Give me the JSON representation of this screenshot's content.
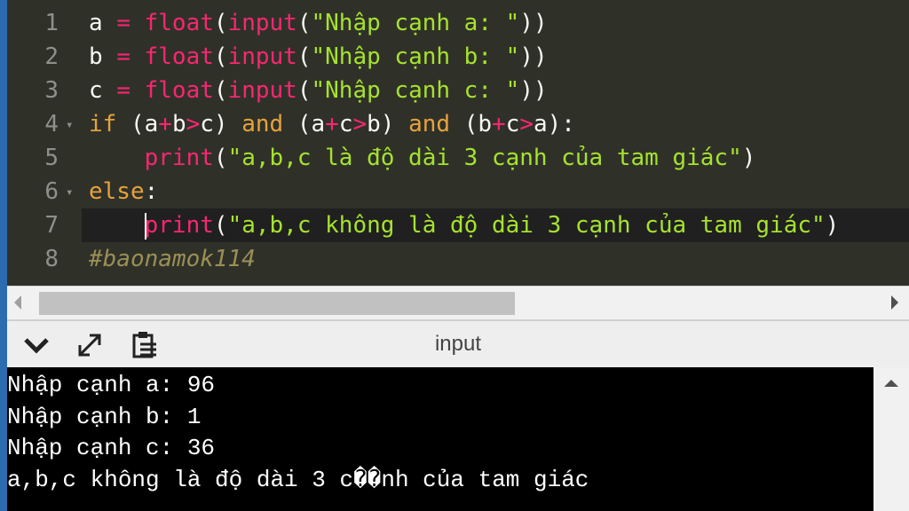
{
  "editor": {
    "lines": [
      {
        "num": "1",
        "parts": [
          {
            "t": "a ",
            "c": ""
          },
          {
            "t": "=",
            "c": "op"
          },
          {
            "t": " ",
            "c": ""
          },
          {
            "t": "float",
            "c": "kw"
          },
          {
            "t": "(",
            "c": ""
          },
          {
            "t": "input",
            "c": "kw"
          },
          {
            "t": "(",
            "c": ""
          },
          {
            "t": "\"Nhập cạnh a: \"",
            "c": "str"
          },
          {
            "t": "))",
            "c": ""
          }
        ]
      },
      {
        "num": "2",
        "parts": [
          {
            "t": "b ",
            "c": ""
          },
          {
            "t": "=",
            "c": "op"
          },
          {
            "t": " ",
            "c": ""
          },
          {
            "t": "float",
            "c": "kw"
          },
          {
            "t": "(",
            "c": ""
          },
          {
            "t": "input",
            "c": "kw"
          },
          {
            "t": "(",
            "c": ""
          },
          {
            "t": "\"Nhập cạnh b: \"",
            "c": "str"
          },
          {
            "t": "))",
            "c": ""
          }
        ]
      },
      {
        "num": "3",
        "parts": [
          {
            "t": "c ",
            "c": ""
          },
          {
            "t": "=",
            "c": "op"
          },
          {
            "t": " ",
            "c": ""
          },
          {
            "t": "float",
            "c": "kw"
          },
          {
            "t": "(",
            "c": ""
          },
          {
            "t": "input",
            "c": "kw"
          },
          {
            "t": "(",
            "c": ""
          },
          {
            "t": "\"Nhập cạnh c: \"",
            "c": "str"
          },
          {
            "t": "))",
            "c": ""
          }
        ]
      },
      {
        "num": "4",
        "fold": true,
        "parts": [
          {
            "t": "if",
            "c": "ctl"
          },
          {
            "t": " (a",
            "c": ""
          },
          {
            "t": "+",
            "c": "op"
          },
          {
            "t": "b",
            "c": ""
          },
          {
            "t": ">",
            "c": "op"
          },
          {
            "t": "c) ",
            "c": ""
          },
          {
            "t": "and",
            "c": "ctl"
          },
          {
            "t": " (a",
            "c": ""
          },
          {
            "t": "+",
            "c": "op"
          },
          {
            "t": "c",
            "c": ""
          },
          {
            "t": ">",
            "c": "op"
          },
          {
            "t": "b) ",
            "c": ""
          },
          {
            "t": "and",
            "c": "ctl"
          },
          {
            "t": " (b",
            "c": ""
          },
          {
            "t": "+",
            "c": "op"
          },
          {
            "t": "c",
            "c": ""
          },
          {
            "t": ">",
            "c": "op"
          },
          {
            "t": "a):",
            "c": ""
          }
        ]
      },
      {
        "num": "5",
        "parts": [
          {
            "t": "    ",
            "c": ""
          },
          {
            "t": "print",
            "c": "kw"
          },
          {
            "t": "(",
            "c": ""
          },
          {
            "t": "\"a,b,c là độ dài 3 cạnh của tam giác\"",
            "c": "str"
          },
          {
            "t": ")",
            "c": ""
          }
        ]
      },
      {
        "num": "6",
        "fold": true,
        "parts": [
          {
            "t": "else",
            "c": "ctl"
          },
          {
            "t": ":",
            "c": ""
          }
        ]
      },
      {
        "num": "7",
        "active": true,
        "cursor": true,
        "parts": [
          {
            "t": "    ",
            "c": ""
          },
          {
            "t": "print",
            "c": "kw"
          },
          {
            "t": "(",
            "c": ""
          },
          {
            "t": "\"a,b,c không là độ dài 3 cạnh của tam giác\"",
            "c": "str"
          },
          {
            "t": ")",
            "c": ""
          }
        ]
      },
      {
        "num": "8",
        "parts": [
          {
            "t": "#baonamok114",
            "c": "cmt"
          }
        ]
      }
    ]
  },
  "console": {
    "title": "input",
    "lines": [
      "Nhập cạnh a: 96",
      "Nhập cạnh b: 1",
      "Nhập cạnh c: 36",
      "a,b,c không là độ dài 3 c��nh của tam giác"
    ]
  },
  "toolbar": {
    "icons": [
      "chevron-down-icon",
      "expand-icon",
      "clipboard-icon"
    ]
  },
  "colors": {
    "editor_bg": "#2f3129",
    "keyword": "#f92672",
    "control": "#e6a23c",
    "string": "#a6e22e",
    "comment": "#9a8f55",
    "console_bg": "#000000"
  }
}
